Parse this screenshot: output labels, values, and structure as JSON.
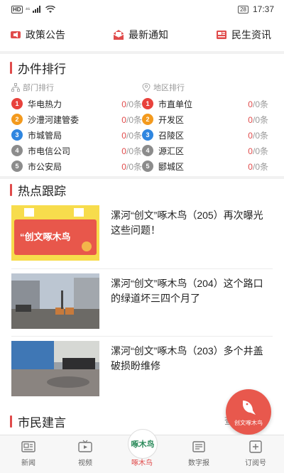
{
  "status_bar": {
    "hd": "HD",
    "signal_text": "⁴⁶",
    "battery": "28",
    "time": "17:37"
  },
  "top_menu": [
    {
      "label": "政策公告",
      "icon": "speaker-icon"
    },
    {
      "label": "最新通知",
      "icon": "envelope-icon"
    },
    {
      "label": "民生资讯",
      "icon": "newspaper-icon"
    }
  ],
  "rank": {
    "title": "办件排行",
    "dept_header": "部门排行",
    "area_header": "地区排行",
    "count_suffix": "/0条",
    "departments": [
      {
        "rank": "1",
        "name": "华电热力",
        "count": "0"
      },
      {
        "rank": "2",
        "name": "沙澧河建管委",
        "count": "0"
      },
      {
        "rank": "3",
        "name": "市城管局",
        "count": "0"
      },
      {
        "rank": "4",
        "name": "市电信公司",
        "count": "0"
      },
      {
        "rank": "5",
        "name": "市公安局",
        "count": "0"
      }
    ],
    "areas": [
      {
        "rank": "1",
        "name": "市直单位",
        "count": "0"
      },
      {
        "rank": "2",
        "name": "开发区",
        "count": "0"
      },
      {
        "rank": "3",
        "name": "召陵区",
        "count": "0"
      },
      {
        "rank": "4",
        "name": "源汇区",
        "count": "0"
      },
      {
        "rank": "5",
        "name": "郾城区",
        "count": "0"
      }
    ]
  },
  "hot": {
    "title": "热点跟踪",
    "thumb1_text": "“创文啄木鸟",
    "items": [
      {
        "title": "漯河“创文”啄木鸟（205）再次曝光这些问题！"
      },
      {
        "title": "漯河“创文”啄木鸟（204）这个路口的绿道坏三四个月了"
      },
      {
        "title": "漯河“创文”啄木鸟（203）多个井盖破损盼维修"
      }
    ]
  },
  "advice": {
    "title": "市民建言",
    "more": "查看"
  },
  "float_button": {
    "label": "创文啄木鸟"
  },
  "tabs": [
    {
      "label": "新闻"
    },
    {
      "label": "视频"
    },
    {
      "label": "啄木鸟"
    },
    {
      "label": "数字报"
    },
    {
      "label": "订阅号"
    }
  ],
  "center_logo_text": "啄木鸟",
  "colors": {
    "accent": "#e04b4b",
    "medal_1": "#e8423c",
    "medal_2": "#f39a1e",
    "medal_3": "#2f86e0",
    "medal_other": "#8c8c8c"
  }
}
